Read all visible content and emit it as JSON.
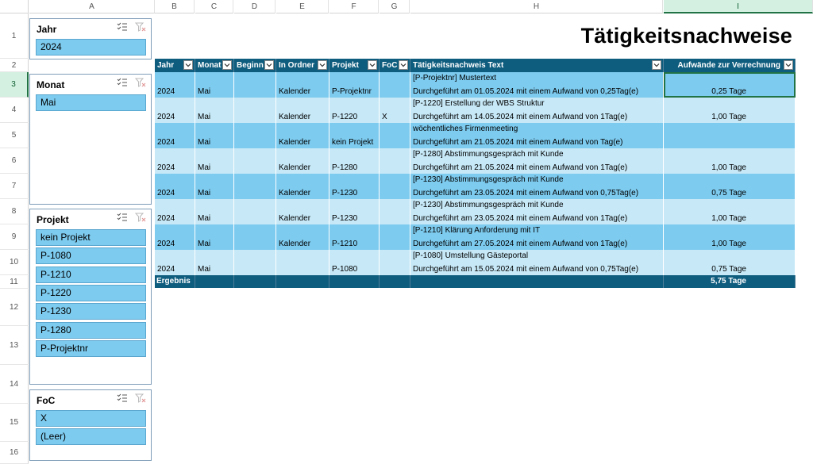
{
  "columns": [
    "A",
    "B",
    "C",
    "D",
    "E",
    "F",
    "G",
    "H",
    "I"
  ],
  "rows": [
    "1",
    "2",
    "3",
    "4",
    "5",
    "6",
    "7",
    "8",
    "9",
    "10",
    "11",
    "12",
    "13",
    "14",
    "15",
    "16"
  ],
  "selected_column": "I",
  "selected_row": "3",
  "title": "Tätigkeitsnachweise",
  "slicers": {
    "jahr": {
      "title": "Jahr",
      "items": [
        "2024"
      ]
    },
    "monat": {
      "title": "Monat",
      "items": [
        "Mai"
      ]
    },
    "projekt": {
      "title": "Projekt",
      "items": [
        "kein Projekt",
        "P-1080",
        "P-1210",
        "P-1220",
        "P-1230",
        "P-1280",
        "P-Projektnr"
      ]
    },
    "foc": {
      "title": "FoC",
      "items": [
        "X",
        "(Leer)"
      ]
    }
  },
  "table": {
    "headers": [
      "Jahr",
      "Monat",
      "Beginn",
      "In Ordner",
      "Projekt",
      "FoC",
      "Tätigkeitsnachweis Text",
      "Aufwände zur Verrechnung"
    ],
    "rows": [
      {
        "jahr": "2024",
        "monat": "Mai",
        "beginn": "",
        "ordner": "Kalender",
        "projekt": "P-Projektnr",
        "foc": "",
        "text1": "[P-Projektnr] Mustertext",
        "text2": "Durchgeführt am 01.05.2024 mit einem Aufwand von 0,25Tag(e)",
        "aufwand": "0,25 Tage"
      },
      {
        "jahr": "2024",
        "monat": "Mai",
        "beginn": "",
        "ordner": "Kalender",
        "projekt": "P-1220",
        "foc": "X",
        "text1": "[P-1220] Erstellung der WBS Struktur",
        "text2": "Durchgeführt am 14.05.2024 mit einem Aufwand von 1Tag(e)",
        "aufwand": "1,00 Tage"
      },
      {
        "jahr": "2024",
        "monat": "Mai",
        "beginn": "",
        "ordner": "Kalender",
        "projekt": "kein Projekt",
        "foc": "",
        "text1": "wöchentliches Firmenmeeting",
        "text2": "Durchgeführt am 21.05.2024 mit einem Aufwand von Tag(e)",
        "aufwand": ""
      },
      {
        "jahr": "2024",
        "monat": "Mai",
        "beginn": "",
        "ordner": "Kalender",
        "projekt": "P-1280",
        "foc": "",
        "text1": "[P-1280] Abstimmungsgespräch mit Kunde",
        "text2": "Durchgeführt am 21.05.2024 mit einem Aufwand von 1Tag(e)",
        "aufwand": "1,00 Tage"
      },
      {
        "jahr": "2024",
        "monat": "Mai",
        "beginn": "",
        "ordner": "Kalender",
        "projekt": "P-1230",
        "foc": "",
        "text1": "[P-1230] Abstimmungsgespräch mit Kunde",
        "text2": "Durchgeführt am 23.05.2024 mit einem Aufwand von 0,75Tag(e)",
        "aufwand": "0,75 Tage"
      },
      {
        "jahr": "2024",
        "monat": "Mai",
        "beginn": "",
        "ordner": "Kalender",
        "projekt": "P-1230",
        "foc": "",
        "text1": "[P-1230] Abstimmungsgespräch mit Kunde",
        "text2": "Durchgeführt am 23.05.2024 mit einem Aufwand von 1Tag(e)",
        "aufwand": "1,00 Tage"
      },
      {
        "jahr": "2024",
        "monat": "Mai",
        "beginn": "",
        "ordner": "Kalender",
        "projekt": "P-1210",
        "foc": "",
        "text1": "[P-1210] Klärung Anforderung mit IT",
        "text2": "Durchgeführt am 27.05.2024 mit einem Aufwand von 1Tag(e)",
        "aufwand": "1,00 Tage"
      },
      {
        "jahr": "2024",
        "monat": "Mai",
        "beginn": "",
        "ordner": "",
        "projekt": "P-1080",
        "foc": "",
        "text1": "[P-1080] Umstellung Gästeportal",
        "text2": "Durchgeführt am 15.05.2024 mit einem Aufwand von 0,75Tag(e)",
        "aufwand": "0,75 Tage"
      }
    ],
    "total_label": "Ergebnis",
    "total_value": "5,75 Tage"
  },
  "colors": {
    "header": "#0e5c7e",
    "row_dark": "#7dcbef",
    "row_light": "#c6e8f7",
    "slicer_item": "#7dcbef",
    "selection": "#217346"
  },
  "icons": [
    "multi-select-icon",
    "clear-filter-icon",
    "dropdown-arrow-icon"
  ]
}
